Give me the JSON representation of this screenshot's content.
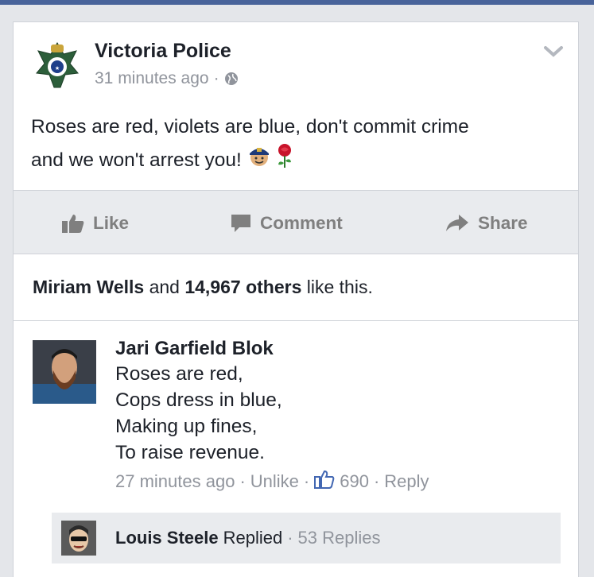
{
  "post": {
    "page_name": "Victoria Police",
    "time": "31 minutes ago",
    "separator": "·",
    "text_line1": "Roses are red, violets are blue, don't commit crime",
    "text_line2": "and we won't arrest you!",
    "emojis": [
      "police-officer-emoji",
      "rose-emoji"
    ]
  },
  "actions": {
    "like": "Like",
    "comment": "Comment",
    "share": "Share"
  },
  "likes": {
    "name": "Miriam Wells",
    "and": "and",
    "count": "14,967 others",
    "suffix": "like this."
  },
  "comment": {
    "author": "Jari Garfield Blok",
    "lines": [
      "Roses are red,",
      "Cops dress in blue,",
      "Making up fines,",
      "To raise revenue."
    ],
    "time": "27 minutes ago",
    "unlike": "Unlike",
    "like_count": "690",
    "reply": "Reply",
    "separator": "·"
  },
  "reply_summary": {
    "name": "Louis Steele",
    "verb": "Replied",
    "separator": "·",
    "count": "53 Replies"
  },
  "colors": {
    "topbar": "#48639a",
    "muted_text": "#90949c",
    "action_text": "#7f7f7f",
    "like_blue": "#4267b2"
  }
}
